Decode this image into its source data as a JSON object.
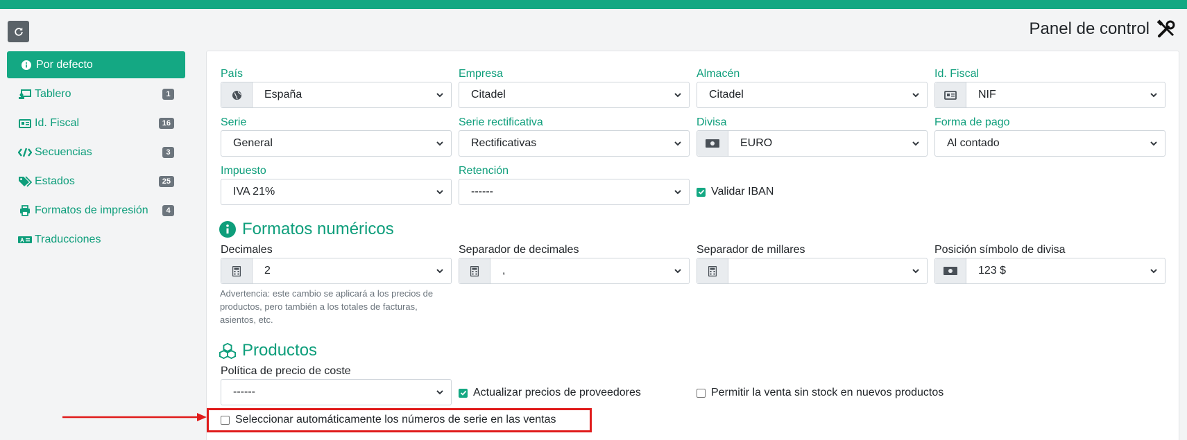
{
  "header": {
    "title": "Panel de control"
  },
  "sidebar": {
    "items": [
      {
        "label": "Por defecto",
        "icon": "info-circle-icon",
        "active": true
      },
      {
        "label": "Tablero",
        "icon": "desktop-user-icon",
        "badge": "1"
      },
      {
        "label": "Id. Fiscal",
        "icon": "id-card-icon",
        "badge": "16"
      },
      {
        "label": "Secuencias",
        "icon": "code-icon",
        "badge": "3"
      },
      {
        "label": "Estados",
        "icon": "tags-icon",
        "badge": "25"
      },
      {
        "label": "Formatos de impresión",
        "icon": "print-icon",
        "badge": "4"
      },
      {
        "label": "Traducciones",
        "icon": "language-icon"
      }
    ]
  },
  "form": {
    "pais": {
      "label": "País",
      "value": "España"
    },
    "empresa": {
      "label": "Empresa",
      "value": "Citadel"
    },
    "almacen": {
      "label": "Almacén",
      "value": "Citadel"
    },
    "id_fiscal": {
      "label": "Id. Fiscal",
      "value": "NIF"
    },
    "serie": {
      "label": "Serie",
      "value": "General"
    },
    "serie_rect": {
      "label": "Serie rectificativa",
      "value": "Rectificativas"
    },
    "divisa": {
      "label": "Divisa",
      "value": "EURO"
    },
    "forma_pago": {
      "label": "Forma de pago",
      "value": "Al contado"
    },
    "impuesto": {
      "label": "Impuesto",
      "value": "IVA 21%"
    },
    "retencion": {
      "label": "Retención",
      "value": "------"
    },
    "validar_iban": {
      "label": "Validar IBAN",
      "checked": true
    }
  },
  "numeric": {
    "title": "Formatos numéricos",
    "decimales": {
      "label": "Decimales",
      "value": "2"
    },
    "sep_decimales": {
      "label": "Separador de decimales",
      "value": ","
    },
    "sep_millares": {
      "label": "Separador de millares",
      "value": ""
    },
    "pos_divisa": {
      "label": "Posición símbolo de divisa",
      "value": "123 $"
    },
    "warning": "Advertencia: este cambio se aplicará a los precios de productos, pero también a los totales de facturas, asientos, etc."
  },
  "products": {
    "title": "Productos",
    "politica": {
      "label": "Política de precio de coste",
      "value": "------"
    },
    "actualizar": {
      "label": "Actualizar precios de proveedores",
      "checked": true
    },
    "permitir": {
      "label": "Permitir la venta sin stock en nuevos productos",
      "checked": false
    },
    "seleccionar": {
      "label": "Seleccionar automáticamente los números de serie en las ventas",
      "checked": false
    }
  },
  "colors": {
    "accent": "#14a883",
    "text_accent": "#0e9e7b",
    "annotation": "#e01b1b"
  }
}
